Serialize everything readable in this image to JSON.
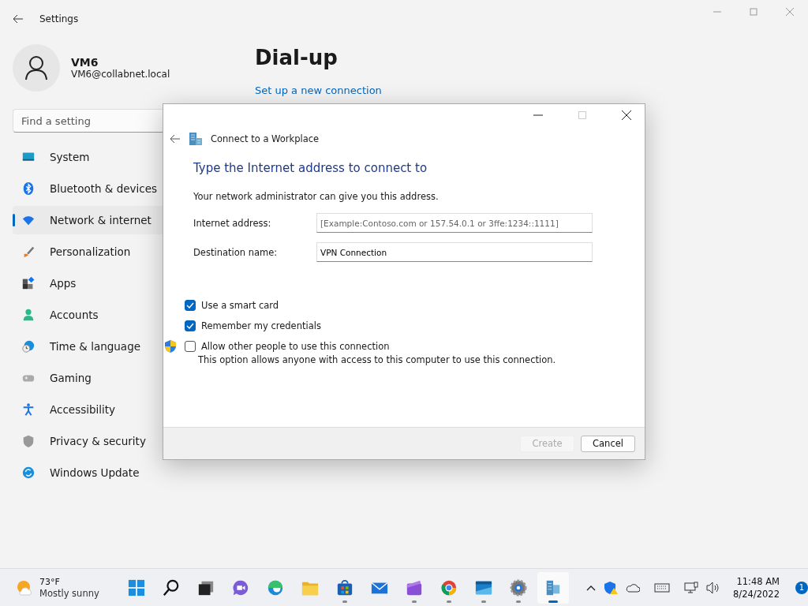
{
  "settings": {
    "title": "Settings",
    "user": {
      "name": "VM6",
      "email": "VM6@collabnet.local"
    },
    "search": {
      "placeholder": "Find a setting"
    },
    "nav": [
      {
        "label": "System",
        "selected": false
      },
      {
        "label": "Bluetooth & devices",
        "selected": false
      },
      {
        "label": "Network & internet",
        "selected": true
      },
      {
        "label": "Personalization",
        "selected": false
      },
      {
        "label": "Apps",
        "selected": false
      },
      {
        "label": "Accounts",
        "selected": false
      },
      {
        "label": "Time & language",
        "selected": false
      },
      {
        "label": "Gaming",
        "selected": false
      },
      {
        "label": "Accessibility",
        "selected": false
      },
      {
        "label": "Privacy & security",
        "selected": false
      },
      {
        "label": "Windows Update",
        "selected": false
      }
    ],
    "page_title": "Dial-up",
    "link": "Set up a new connection"
  },
  "dialog": {
    "title": "Connect to a Workplace",
    "heading": "Type the Internet address to connect to",
    "intro": "Your network administrator can give you this address.",
    "fields": [
      {
        "label": "Internet address:",
        "placeholder": "[Example:Contoso.com or 157.54.0.1 or 3ffe:1234::1111]"
      },
      {
        "label": "Destination name:",
        "value": "VPN Connection"
      }
    ],
    "options": [
      {
        "label": "Use a smart card",
        "checked": true,
        "shield": false
      },
      {
        "label": "Remember my credentials",
        "checked": true,
        "shield": false
      },
      {
        "label": "Allow other people to use this connection",
        "checked": false,
        "shield": true,
        "note": "This option allows anyone with access to this computer to use this connection."
      }
    ],
    "buttons": [
      {
        "label": "Create",
        "disabled": true
      },
      {
        "label": "Cancel",
        "disabled": false
      }
    ]
  },
  "taskbar": {
    "weather": {
      "temp": "73°F",
      "text": "Mostly sunny"
    },
    "apps": [
      {
        "running": false,
        "active": false
      },
      {
        "running": false,
        "active": false
      },
      {
        "running": false,
        "active": false
      },
      {
        "running": false,
        "active": false
      },
      {
        "running": false,
        "active": false
      },
      {
        "running": false,
        "active": false
      },
      {
        "running": true,
        "active": false
      },
      {
        "running": false,
        "active": false
      },
      {
        "running": true,
        "active": false
      },
      {
        "running": true,
        "active": false
      },
      {
        "running": true,
        "active": false
      },
      {
        "running": true,
        "active": false
      },
      {
        "running": true,
        "active": true
      }
    ],
    "time": "11:48 AM",
    "date": "8/24/2022",
    "badge": "1"
  }
}
